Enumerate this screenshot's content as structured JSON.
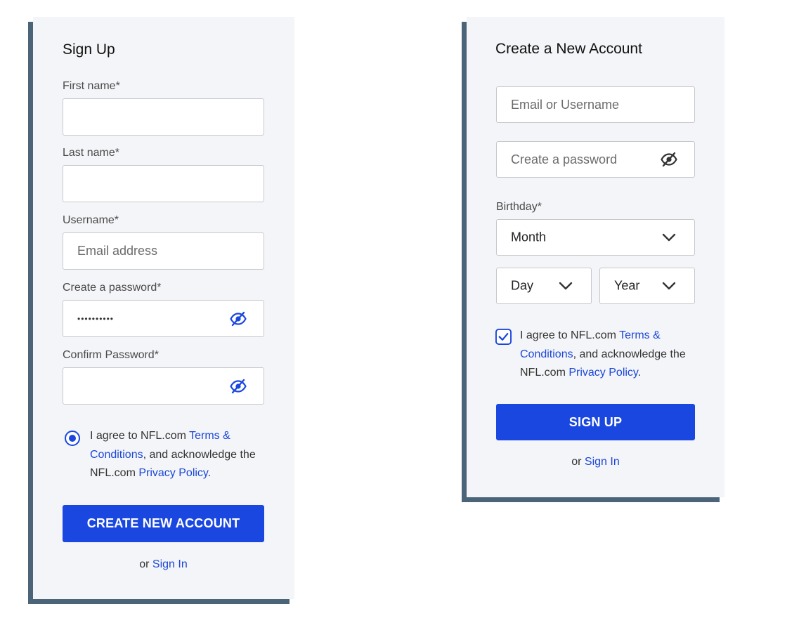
{
  "left_form": {
    "title": "Sign Up",
    "first_name_label": "First name*",
    "last_name_label": "Last name*",
    "username_label": "Username*",
    "username_placeholder": "Email address",
    "password_label": "Create a password*",
    "password_value": "••••••••••",
    "confirm_label": "Confirm Password*",
    "agree_prefix": "I agree to NFL.com ",
    "terms_link": "Terms & Conditions",
    "agree_middle": ", and acknowledge the NFL.com ",
    "privacy_link": "Privacy Policy",
    "agree_suffix": ".",
    "submit_label": "CREATE NEW ACCOUNT",
    "or_text": "or ",
    "signin_link": "Sign In"
  },
  "right_form": {
    "title": "Create a New Account",
    "email_placeholder": "Email or Username",
    "password_placeholder": "Create a password",
    "birthday_label": "Birthday*",
    "month_value": "Month",
    "day_value": "Day",
    "year_value": "Year",
    "agree_prefix": "I agree to NFL.com ",
    "terms_link": "Terms & Conditions",
    "agree_middle": ", and acknowledge the NFL.com ",
    "privacy_link": "Privacy Policy",
    "agree_suffix": ".",
    "submit_label": "SIGN UP",
    "or_text": "or ",
    "signin_link": "Sign In"
  },
  "colors": {
    "accent": "#1a47e0",
    "card_background": "#f4f5f8",
    "card_shadow": "#4b6478"
  },
  "icons": {
    "eye": "eye-slash-icon",
    "chevron": "chevron-down-icon",
    "radio": "radio-selected-icon",
    "checkbox": "checkbox-checked-icon"
  }
}
